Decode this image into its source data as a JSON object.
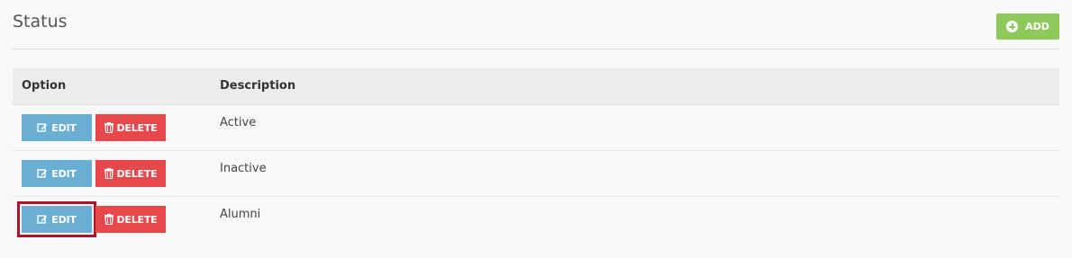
{
  "header": {
    "title": "Status",
    "add_label": "ADD"
  },
  "table": {
    "columns": [
      "Option",
      "Description"
    ],
    "rows": [
      {
        "edit_label": "EDIT",
        "delete_label": "DELETE",
        "description": "Active"
      },
      {
        "edit_label": "EDIT",
        "delete_label": "DELETE",
        "description": "Inactive"
      },
      {
        "edit_label": "EDIT",
        "delete_label": "DELETE",
        "description": "Alumni"
      }
    ]
  },
  "colors": {
    "add": "#8dc95b",
    "edit": "#6aafd3",
    "delete": "#e8474b",
    "selection_outline": "#b01228"
  }
}
